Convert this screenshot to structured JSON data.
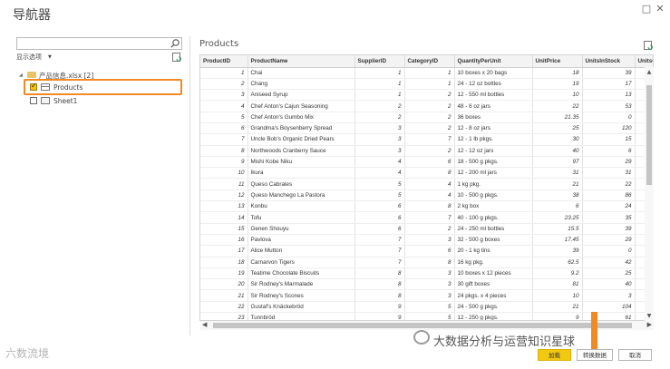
{
  "window": {
    "title": "导航器",
    "controls": [
      "□",
      "✕"
    ]
  },
  "navigator": {
    "search_placeholder": "",
    "display_options_label": "显示选项",
    "file_node": "产品信息.xlsx [2]",
    "items": [
      {
        "label": "Products",
        "checked": true
      },
      {
        "label": "Sheet1",
        "checked": false
      }
    ]
  },
  "preview": {
    "title": "Products",
    "columns": [
      "ProductID",
      "ProductName",
      "SupplierID",
      "CategoryID",
      "QuantityPerUnit",
      "UnitPrice",
      "UnitsInStock",
      "UnitsOn"
    ],
    "rows": [
      [
        "1",
        "Chai",
        "1",
        "1",
        "10 boxes x 20 bags",
        "18",
        "39",
        ""
      ],
      [
        "2",
        "Chang",
        "1",
        "1",
        "24 - 12 oz bottles",
        "19",
        "17",
        ""
      ],
      [
        "3",
        "Aniseed Syrup",
        "1",
        "2",
        "12 - 550 ml bottles",
        "10",
        "13",
        ""
      ],
      [
        "4",
        "Chef Anton's Cajun Seasoning",
        "2",
        "2",
        "48 - 6 oz jars",
        "22",
        "53",
        ""
      ],
      [
        "5",
        "Chef Anton's Gumbo Mix",
        "2",
        "2",
        "36 boxes",
        "21.35",
        "0",
        ""
      ],
      [
        "6",
        "Grandma's Boysenberry Spread",
        "3",
        "2",
        "12 - 8 oz jars",
        "25",
        "120",
        ""
      ],
      [
        "7",
        "Uncle Bob's Organic Dried Pears",
        "3",
        "7",
        "12 - 1 lb pkgs.",
        "30",
        "15",
        ""
      ],
      [
        "8",
        "Northwoods Cranberry Sauce",
        "3",
        "2",
        "12 - 12 oz jars",
        "40",
        "6",
        ""
      ],
      [
        "9",
        "Mishi Kobe Niku",
        "4",
        "6",
        "18 - 500 g pkgs.",
        "97",
        "29",
        ""
      ],
      [
        "10",
        "Ikura",
        "4",
        "8",
        "12 - 200 ml jars",
        "31",
        "31",
        ""
      ],
      [
        "11",
        "Queso Cabrales",
        "5",
        "4",
        "1 kg pkg.",
        "21",
        "22",
        ""
      ],
      [
        "12",
        "Queso Manchego La Pastora",
        "5",
        "4",
        "10 - 500 g pkgs.",
        "38",
        "86",
        ""
      ],
      [
        "13",
        "Konbu",
        "6",
        "8",
        "2 kg box",
        "6",
        "24",
        ""
      ],
      [
        "14",
        "Tofu",
        "6",
        "7",
        "40 - 100 g pkgs.",
        "23.25",
        "35",
        ""
      ],
      [
        "15",
        "Genen Shouyu",
        "6",
        "2",
        "24 - 250 ml bottles",
        "15.5",
        "39",
        ""
      ],
      [
        "16",
        "Pavlova",
        "7",
        "3",
        "32 - 500 g boxes",
        "17.45",
        "29",
        ""
      ],
      [
        "17",
        "Alice Mutton",
        "7",
        "6",
        "20 - 1 kg tins",
        "39",
        "0",
        ""
      ],
      [
        "18",
        "Carnarvon Tigers",
        "7",
        "8",
        "16 kg pkg.",
        "62.5",
        "42",
        ""
      ],
      [
        "19",
        "Teatime Chocolate Biscuits",
        "8",
        "3",
        "10 boxes x 12 pieces",
        "9.2",
        "25",
        ""
      ],
      [
        "20",
        "Sir Rodney's Marmalade",
        "8",
        "3",
        "30 gift boxes",
        "81",
        "40",
        ""
      ],
      [
        "21",
        "Sir Rodney's Scones",
        "8",
        "3",
        "24 pkgs. x 4 pieces",
        "10",
        "3",
        ""
      ],
      [
        "22",
        "Gustaf's Knäckebröd",
        "9",
        "5",
        "24 - 500 g pkgs.",
        "21",
        "104",
        ""
      ],
      [
        "23",
        "Tunnbröd",
        "9",
        "5",
        "12 - 250 g pkgs.",
        "9",
        "61",
        ""
      ]
    ]
  },
  "buttons": {
    "load": "加载",
    "transform": "转换数据",
    "cancel": "取消"
  },
  "watermarks": {
    "left": "六数流境",
    "right": "大数据分析与运营知识星球"
  },
  "colors": {
    "accent_yellow": "#f2c811",
    "annotation_orange": "#f08a24"
  }
}
